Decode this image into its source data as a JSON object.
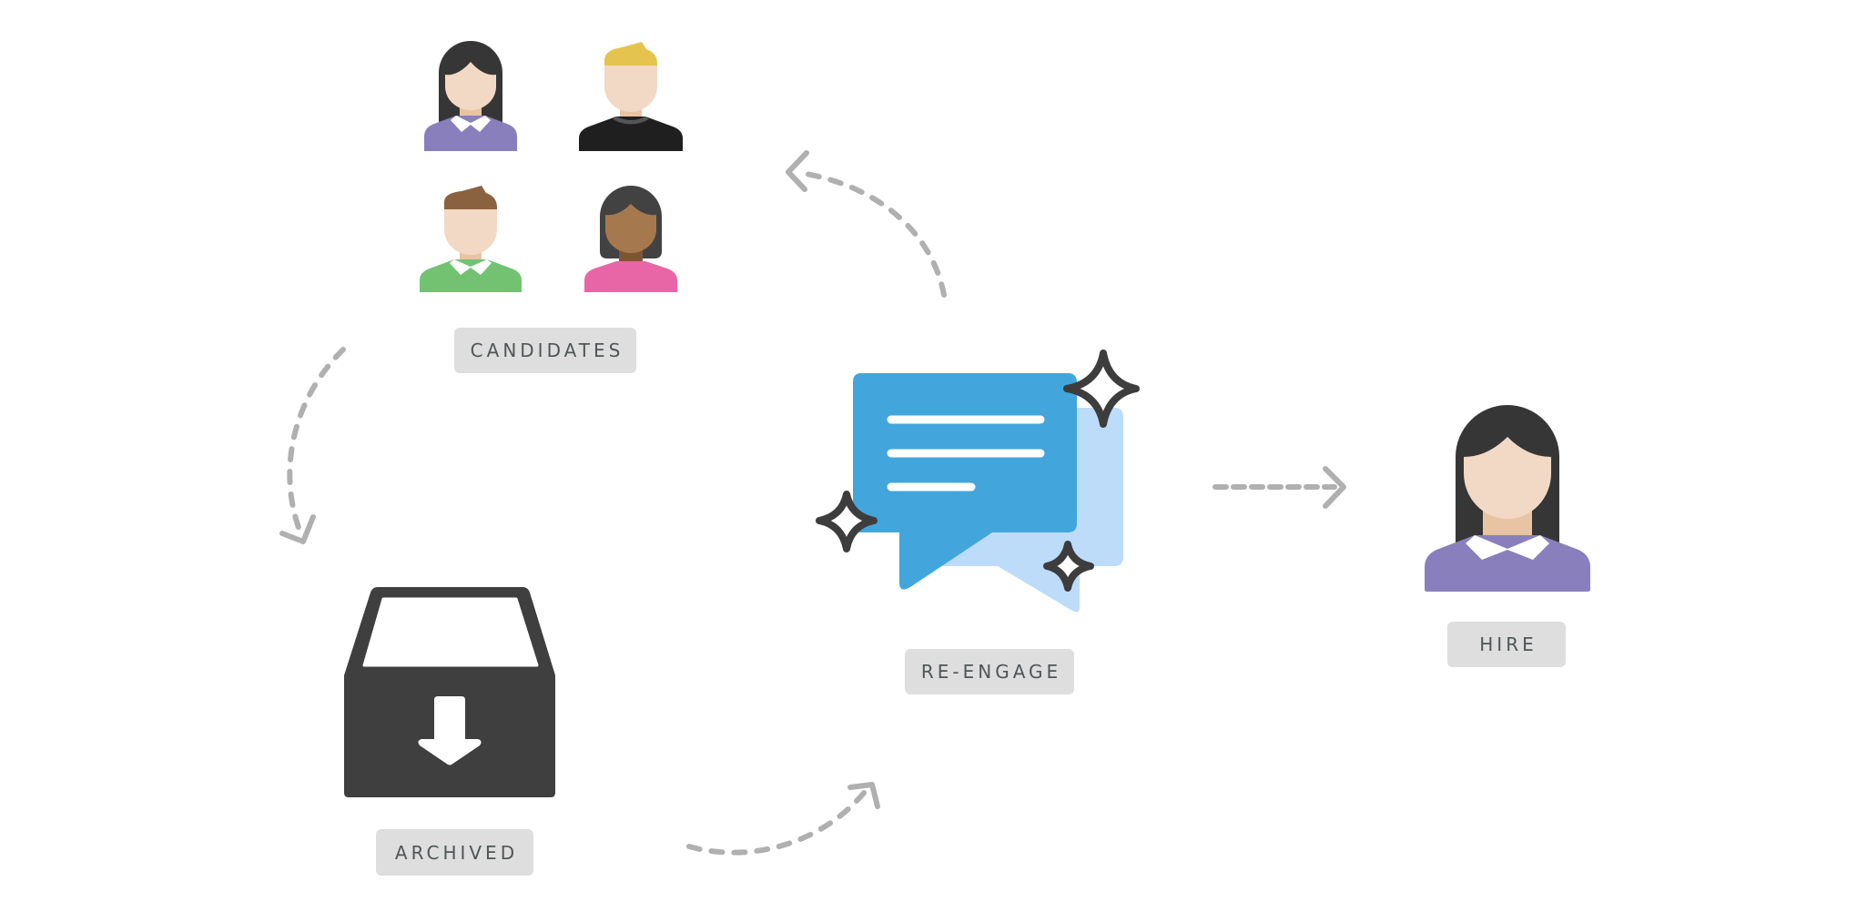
{
  "diagram": {
    "stages": [
      {
        "id": "candidates",
        "label": "CANDIDATES",
        "icon": "people-group-icon"
      },
      {
        "id": "archived",
        "label": "ARCHIVED",
        "icon": "archive-box-icon"
      },
      {
        "id": "re-engage",
        "label": "RE-ENGAGE",
        "icon": "chat-bubbles-sparkle-icon"
      },
      {
        "id": "hire",
        "label": "HIRE",
        "icon": "person-icon"
      }
    ],
    "flows": [
      {
        "from": "candidates",
        "to": "archived",
        "style": "dashed-curved"
      },
      {
        "from": "archived",
        "to": "re-engage",
        "style": "dashed-curved"
      },
      {
        "from": "re-engage",
        "to": "candidates",
        "style": "dashed-curved"
      },
      {
        "from": "re-engage",
        "to": "hire",
        "style": "dashed-straight"
      }
    ]
  },
  "colors": {
    "label_bg": "#dedede",
    "label_text": "#505557",
    "arrow": "#b0b0b0",
    "dark": "#3d3d3d",
    "bubble_front": "#42a6dc",
    "bubble_back": "#bcdcf9",
    "skin_light": "#f2d9c6",
    "skin_neck": "#e9c4a3",
    "skin_dark": "#a6784e",
    "shirt_purple": "#8a7fbd",
    "shirt_black": "#1f1f1f",
    "shirt_green": "#72c272",
    "shirt_pink": "#e866a6",
    "hair_blond": "#e4c44f",
    "hair_brown": "#8b6240"
  }
}
